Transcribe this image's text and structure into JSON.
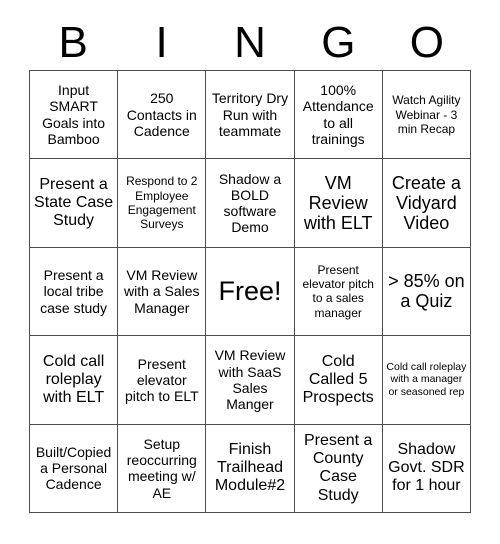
{
  "card": {
    "header_letters": [
      "B",
      "I",
      "N",
      "G",
      "O"
    ],
    "rows": 5,
    "columns": 5,
    "colors": {
      "background": "#ffffff",
      "text": "#000000",
      "grid_line": "#4d4d4d"
    },
    "cells": [
      [
        {
          "text": "Input SMART Goals into Bamboo",
          "size": "m"
        },
        {
          "text": "250 Contacts in Cadence",
          "size": "m"
        },
        {
          "text": "Territory Dry Run with teammate",
          "size": "m"
        },
        {
          "text": "100% Attendance to all trainings",
          "size": "m"
        },
        {
          "text": "Watch Agility Webinar - 3 min Recap",
          "size": "s"
        }
      ],
      [
        {
          "text": "Present a State Case Study",
          "size": "l"
        },
        {
          "text": "Respond to 2 Employee Engagement Surveys",
          "size": "s"
        },
        {
          "text": "Shadow a BOLD software Demo",
          "size": "m"
        },
        {
          "text": "VM Review with ELT",
          "size": "xl"
        },
        {
          "text": "Create a Vidyard Video",
          "size": "xl"
        }
      ],
      [
        {
          "text": "Present a local tribe case study",
          "size": "m"
        },
        {
          "text": "VM Review with a Sales Manager",
          "size": "m"
        },
        {
          "text": "Free!",
          "size": "free"
        },
        {
          "text": "Present elevator pitch to a sales manager",
          "size": "s"
        },
        {
          "text": "> 85% on a Quiz",
          "size": "xl"
        }
      ],
      [
        {
          "text": "Cold call roleplay with ELT",
          "size": "l"
        },
        {
          "text": "Present elevator pitch to ELT",
          "size": "m"
        },
        {
          "text": "VM Review with SaaS Sales Manger",
          "size": "m"
        },
        {
          "text": "Cold Called 5 Prospects",
          "size": "l"
        },
        {
          "text": "Cold call roleplay with a manager or seasoned rep",
          "size": "xs"
        }
      ],
      [
        {
          "text": "Built/Copied a Personal Cadence",
          "size": "m"
        },
        {
          "text": "Setup reoccurring meeting w/ AE",
          "size": "m"
        },
        {
          "text": "Finish Trailhead Module#2",
          "size": "l"
        },
        {
          "text": "Present a County Case Study",
          "size": "l"
        },
        {
          "text": "Shadow Govt. SDR for 1 hour",
          "size": "l"
        }
      ]
    ]
  }
}
